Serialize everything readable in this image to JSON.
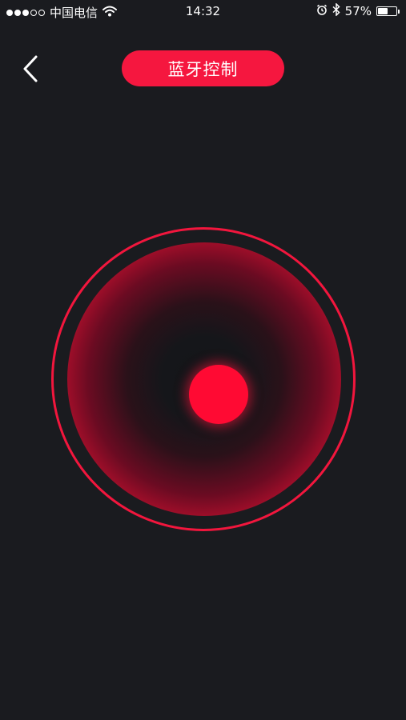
{
  "status_bar": {
    "carrier": "中国电信",
    "time": "14:32",
    "battery_percent": "57%",
    "battery_level": 0.57,
    "signal_bars_on": 3,
    "signal_bars_total": 5
  },
  "nav": {
    "title": "蓝牙控制"
  },
  "colors": {
    "accent": "#f5173f",
    "background": "#1a1b1f"
  }
}
